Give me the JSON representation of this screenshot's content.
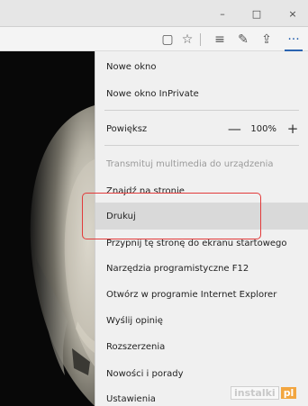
{
  "window_controls": {
    "minimize": "–",
    "maximize": "□",
    "close": "×"
  },
  "toolbar": {
    "icons": [
      "reading-view-icon",
      "favorite-star-icon",
      "hub-icon",
      "web-note-icon",
      "share-icon",
      "more-icon"
    ],
    "reading_view": "▢",
    "favorite": "☆",
    "hub": "≡",
    "web_note": "✎",
    "share": "⇪",
    "more": "···"
  },
  "menu": {
    "items": [
      {
        "label": "Nowe okno",
        "disabled": false
      },
      {
        "label": "Nowe okno InPrivate",
        "disabled": false
      },
      {
        "label": "Powiększ",
        "disabled": false
      },
      {
        "label": "Transmituj multimedia do urządzenia",
        "disabled": true
      },
      {
        "label": "Znajdź na stronie",
        "disabled": false
      },
      {
        "label": "Drukuj",
        "disabled": false
      },
      {
        "label": "Przypnij tę stronę do ekranu startowego",
        "disabled": false
      },
      {
        "label": "Narzędzia programistyczne F12",
        "disabled": false
      },
      {
        "label": "Otwórz w programie Internet Explorer",
        "disabled": false
      },
      {
        "label": "Wyślij opinię",
        "disabled": false
      },
      {
        "label": "Rozszerzenia",
        "disabled": false
      },
      {
        "label": "Nowości i porady",
        "disabled": false
      },
      {
        "label": "Ustawienia",
        "disabled": false
      }
    ],
    "zoom": {
      "minus": "—",
      "value": "100%",
      "plus": "+"
    },
    "highlighted_item": "Drukuj"
  },
  "watermark": {
    "text": "instalki",
    "suffix": "pl"
  },
  "colors": {
    "highlight_box": "#e23a3a",
    "accent": "#2a64b0"
  }
}
